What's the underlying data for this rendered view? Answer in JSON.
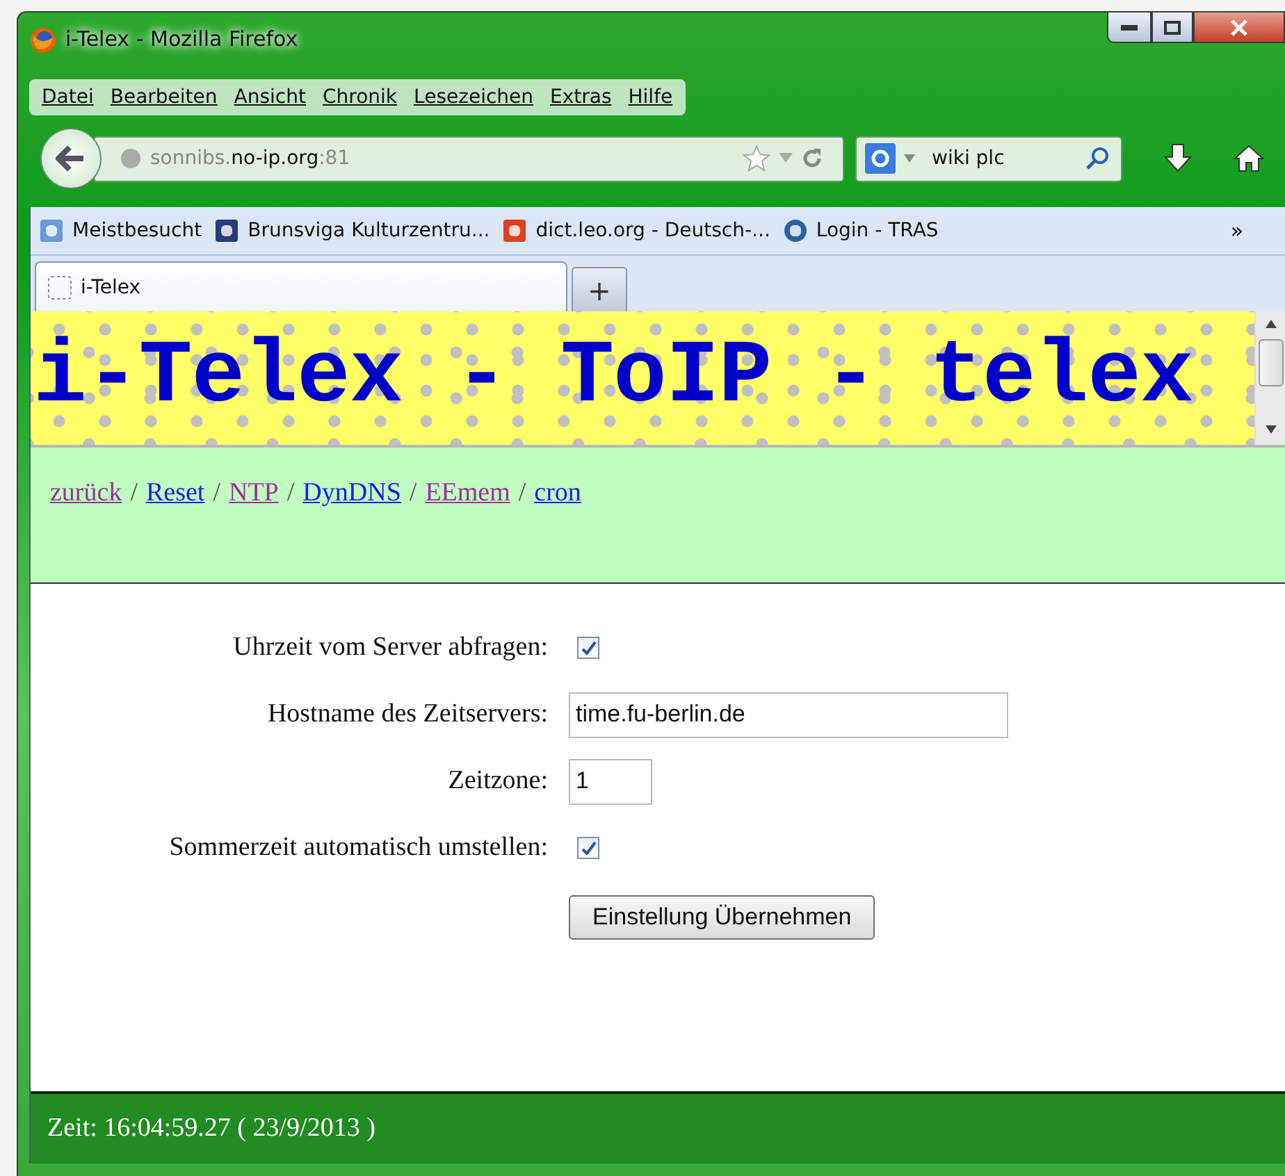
{
  "window": {
    "title": "i-Telex - Mozilla Firefox"
  },
  "menu": [
    "Datei",
    "Bearbeiten",
    "Ansicht",
    "Chronik",
    "Lesezeichen",
    "Extras",
    "Hilfe"
  ],
  "address": {
    "prefix": "sonnibs.",
    "domain": "no-ip.org",
    "suffix": ":81"
  },
  "search": {
    "value": "wiki plc"
  },
  "bookmarks": [
    {
      "label": "Meistbesucht"
    },
    {
      "label": "Brunsviga Kulturzentru..."
    },
    {
      "label": "dict.leo.org - Deutsch-..."
    },
    {
      "label": "Login - TRAS"
    }
  ],
  "bookmarks_more": "»",
  "tabs": [
    {
      "label": "i-Telex",
      "selected": true
    }
  ],
  "new_tab": "+",
  "banner": {
    "title": "i-Telex - ToIP - telex"
  },
  "nav_links": [
    {
      "label": "zurück",
      "visited": true,
      "separator": "/"
    },
    {
      "label": "Reset",
      "visited": false,
      "separator": "/"
    },
    {
      "label": "NTP",
      "visited": true,
      "separator": "/"
    },
    {
      "label": "DynDNS",
      "visited": false,
      "separator": "/"
    },
    {
      "label": "EEmem",
      "visited": true,
      "separator": "/"
    },
    {
      "label": "cron",
      "visited": false
    }
  ],
  "form": {
    "rows": [
      {
        "kind": "checkbox",
        "label": "Uhrzeit vom Server abfragen:",
        "checked": true
      },
      {
        "kind": "widetext",
        "label": "Hostname des Zeitservers:",
        "value": "time.fu-berlin.de"
      },
      {
        "kind": "shorttext",
        "label": "Zeitzone:",
        "value": "1"
      },
      {
        "kind": "checkbox",
        "label": "Sommerzeit automatisch umstellen:",
        "checked": true
      }
    ],
    "button": "Einstellung Übernehmen"
  },
  "footer": {
    "time": "Zeit: 16:04:59.27 ( 23/9/2013 )"
  }
}
